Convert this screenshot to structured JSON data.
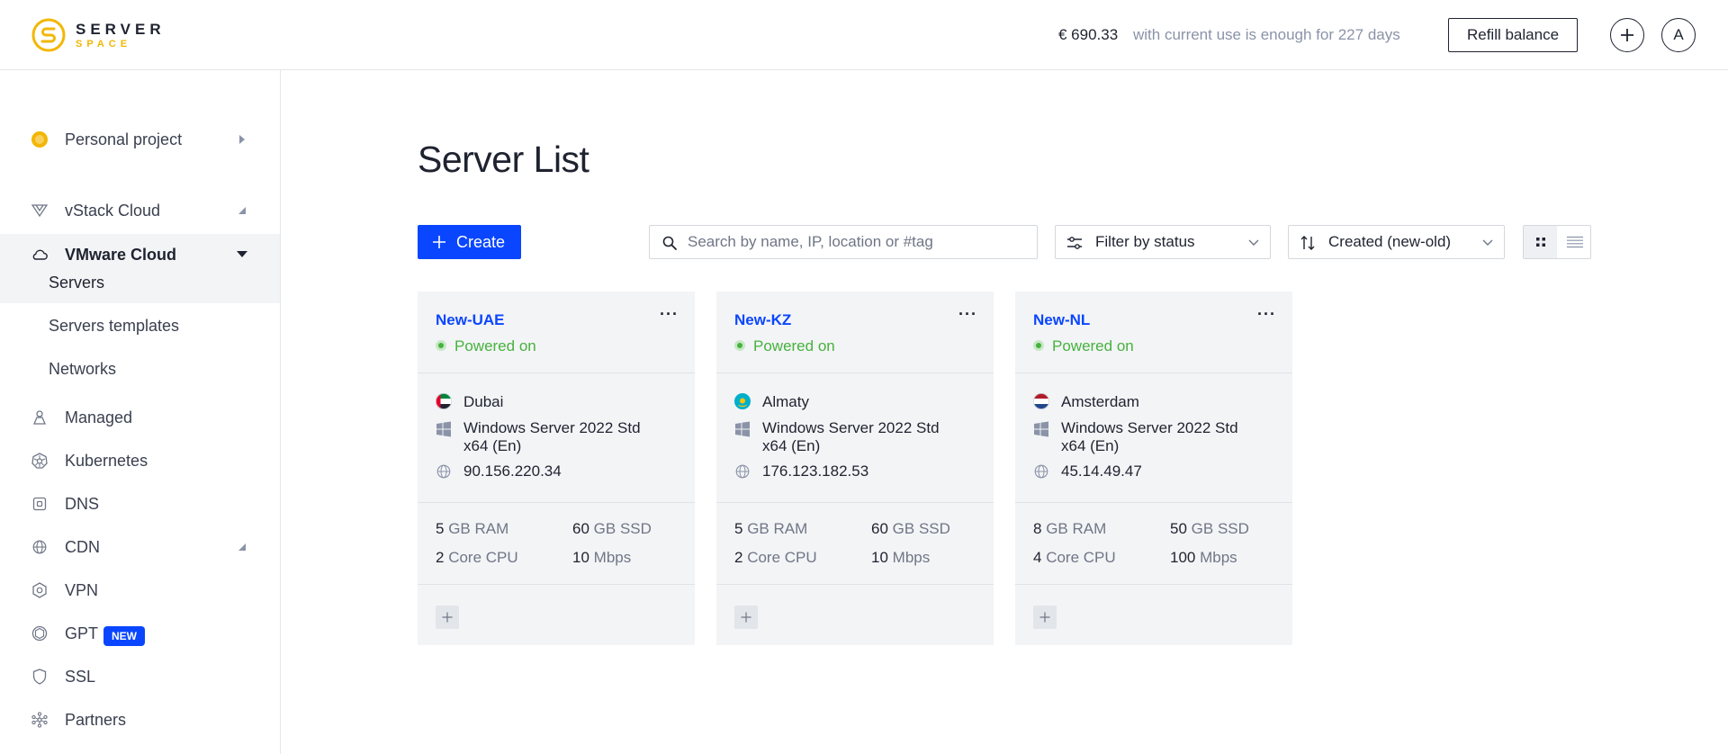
{
  "header": {
    "logo_top": "SERVER",
    "logo_bottom": "SPACE",
    "balance": "€ 690.33",
    "balance_note": "with current use is enough for 227 days",
    "refill_label": "Refill balance",
    "add_label": "+",
    "avatar_letter": "A"
  },
  "sidebar": {
    "project": "Personal project",
    "items": [
      {
        "label": "vStack Cloud",
        "icon": "vstack-icon"
      },
      {
        "label": "VMware Cloud",
        "icon": "cloud-icon"
      },
      {
        "label": "Managed",
        "icon": "managed-icon"
      },
      {
        "label": "Kubernetes",
        "icon": "kubernetes-icon"
      },
      {
        "label": "DNS",
        "icon": "dns-icon"
      },
      {
        "label": "CDN",
        "icon": "globe-icon"
      },
      {
        "label": "VPN",
        "icon": "vpn-icon"
      },
      {
        "label": "GPT",
        "icon": "gpt-icon",
        "badge": "NEW"
      },
      {
        "label": "SSL",
        "icon": "shield-icon"
      },
      {
        "label": "Partners",
        "icon": "partners-icon"
      }
    ],
    "subitems": [
      "Servers",
      "Servers templates",
      "Networks"
    ]
  },
  "main": {
    "title": "Server List",
    "create_label": "Create",
    "search_placeholder": "Search by name, IP, location or #tag",
    "filter_label": "Filter by status",
    "sort_label": "Created (new-old)",
    "view_mode": "grid"
  },
  "cards": [
    {
      "name": "New-UAE",
      "status": "Powered on",
      "location": "Dubai",
      "flag": "uae-flag-icon",
      "os_line1": "Windows Server 2022 Std",
      "os_line2": "x64 (En)",
      "ip": "90.156.220.34",
      "ram_value": "5",
      "ram_unit": "GB RAM",
      "disk_value": "60",
      "disk_unit": "GB SSD",
      "cpu_value": "2",
      "cpu_unit": "Core CPU",
      "net_value": "10",
      "net_unit": "Mbps"
    },
    {
      "name": "New-KZ",
      "status": "Powered on",
      "location": "Almaty",
      "flag": "kazakhstan-flag-icon",
      "os_line1": "Windows Server 2022 Std",
      "os_line2": "x64 (En)",
      "ip": "176.123.182.53",
      "ram_value": "5",
      "ram_unit": "GB RAM",
      "disk_value": "60",
      "disk_unit": "GB SSD",
      "cpu_value": "2",
      "cpu_unit": "Core CPU",
      "net_value": "10",
      "net_unit": "Mbps"
    },
    {
      "name": "New-NL",
      "status": "Powered on",
      "location": "Amsterdam",
      "flag": "netherlands-flag-icon",
      "os_line1": "Windows Server 2022 Std",
      "os_line2": "x64 (En)",
      "ip": "45.14.49.47",
      "ram_value": "8",
      "ram_unit": "GB RAM",
      "disk_value": "50",
      "disk_unit": "GB SSD",
      "cpu_value": "4",
      "cpu_unit": "Core CPU",
      "net_value": "100",
      "net_unit": "Mbps"
    }
  ],
  "colors": {
    "accent": "#0a46ff",
    "status_green": "#46b23e",
    "logo_yellow": "#f2b705",
    "card_bg": "#f3f4f6"
  }
}
